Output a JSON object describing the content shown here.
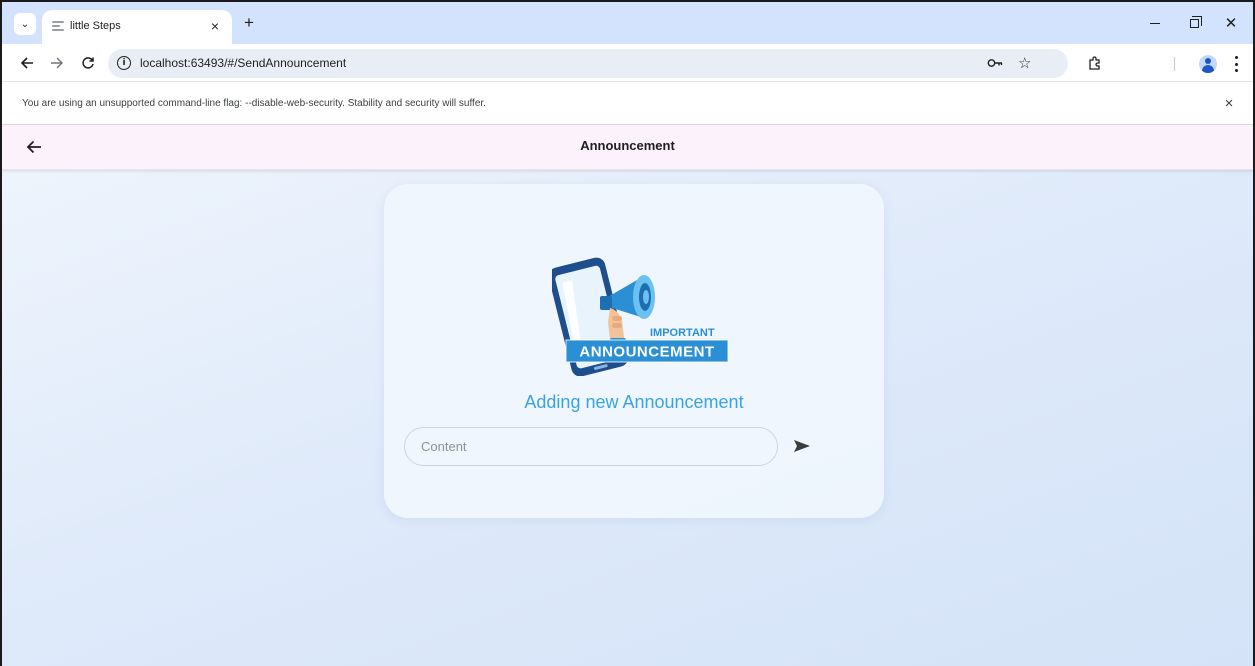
{
  "browser": {
    "tab": {
      "title": "little Steps",
      "close_glyph": "×"
    },
    "new_tab_glyph": "+",
    "url": "localhost:63493/#/SendAnnouncement",
    "infobar": {
      "message": "You are using an unsupported command-line flag: --disable-web-security. Stability and security will suffer.",
      "close_glyph": "×"
    },
    "icons": [
      "tab-list-icon",
      "back-arrow-icon",
      "forward-arrow-icon",
      "reload-icon",
      "site-info-icon",
      "password-key-icon",
      "bookmark-star-icon",
      "extensions-icon",
      "profile-icon",
      "more-menu-icon",
      "minimize-icon",
      "maximize-icon",
      "close-window-icon"
    ]
  },
  "app": {
    "appbar": {
      "title": "Announcement",
      "back_icon": "back-arrow-icon"
    },
    "card": {
      "illustration": {
        "line1": "IMPORTANT",
        "line2": "ANNOUNCEMENT"
      },
      "heading": "Adding new Announcement",
      "input": {
        "placeholder": "Content",
        "value": ""
      },
      "send_icon": "send-icon"
    }
  },
  "colors": {
    "tabstrip": "#d3e3fd",
    "appbar": "#fbf2fb",
    "heading": "#3aa3e0",
    "illustration_blue": "#2a8fd4",
    "phone_navy": "#1f4e8c"
  }
}
